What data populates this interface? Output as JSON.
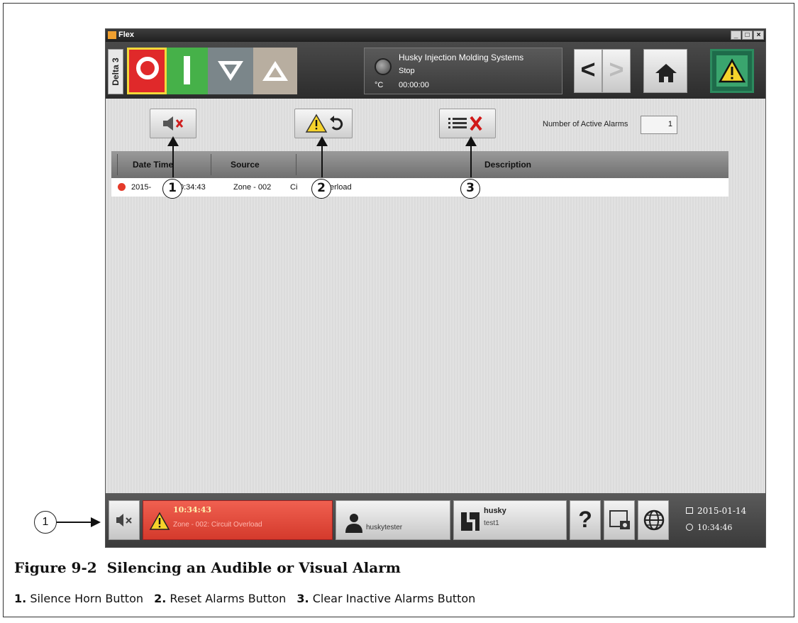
{
  "window": {
    "title": "Flex",
    "controls": [
      "_",
      "□",
      "×"
    ]
  },
  "header": {
    "delta_tab": "Delta 3",
    "status": {
      "company": "Husky Injection Molding Systems",
      "state": "Stop",
      "unit": "°C",
      "timer": "00:00:00"
    },
    "nav_back": "<",
    "nav_forward": ">"
  },
  "toolbar": {
    "active_alarms_label": "Number of Active Alarms",
    "active_alarms_count": "1"
  },
  "table": {
    "columns": [
      "Date Time",
      "Source",
      "Description"
    ],
    "rows": [
      {
        "datetime": "2015-",
        "datetime_tail": "0:34:43",
        "source": "Zone - 002",
        "desc_head": "Ci",
        "desc_tail": "erload"
      }
    ]
  },
  "footer": {
    "alarm_time": "10:34:43",
    "alarm_message": "Zone - 002: Circuit Overload",
    "user": "huskytester",
    "project_name": "husky",
    "project_sub": "test1",
    "help": "?",
    "date": "2015-01-14",
    "time": "10:34:46"
  },
  "callouts": [
    "1",
    "2",
    "3"
  ],
  "outer_callout": "1",
  "figure": {
    "number": "Figure 9-2",
    "title": "Silencing an Audible or Visual Alarm",
    "legend": [
      {
        "num": "1.",
        "text": "Silence Horn Button"
      },
      {
        "num": "2.",
        "text": "Reset Alarms Button"
      },
      {
        "num": "3.",
        "text": "Clear Inactive Alarms Button"
      }
    ]
  },
  "colors": {
    "stop_red": "#e0292a",
    "start_green": "#46b149",
    "alarm_red": "#d43a2c",
    "alarm_green": "#3aa56e"
  }
}
